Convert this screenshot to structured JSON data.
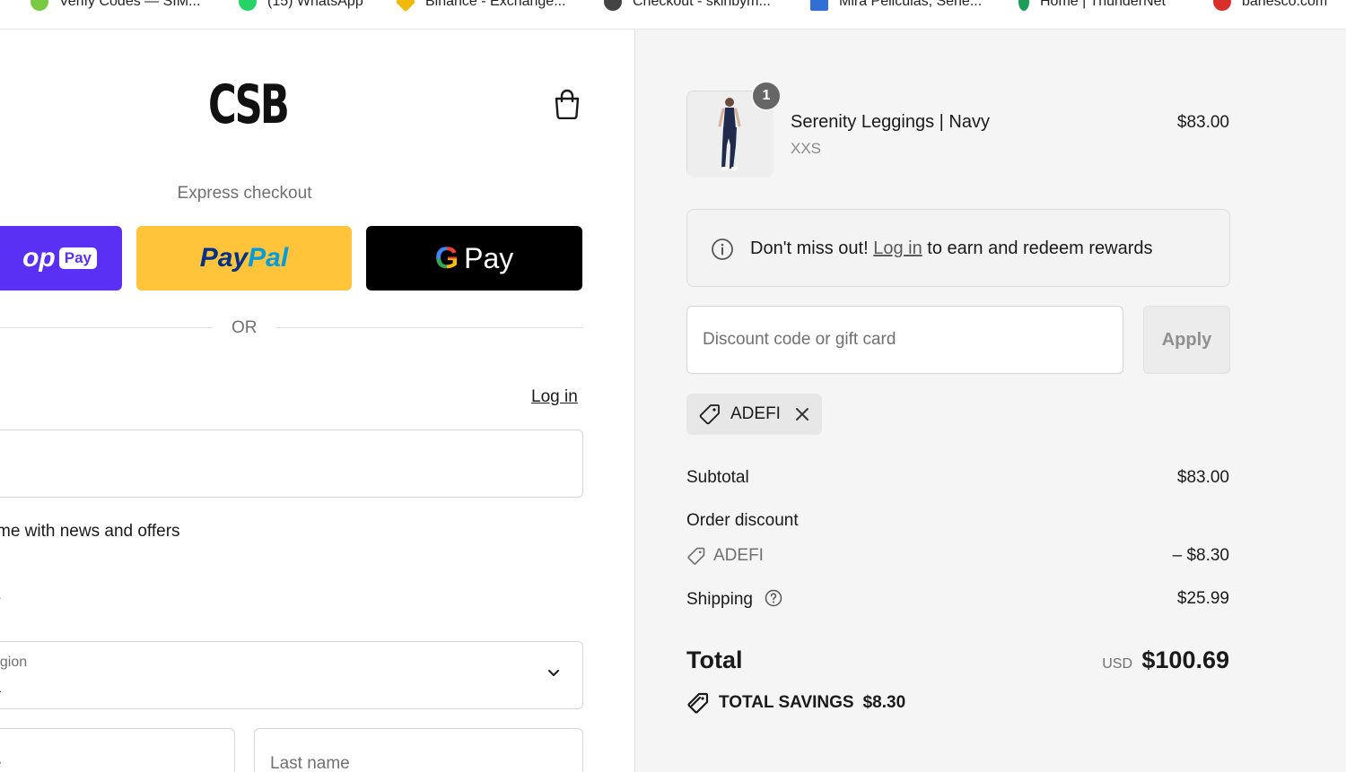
{
  "bookmarks": [
    {
      "label": "Verify Codes — SIM...",
      "icon": "verify-codes-icon",
      "color": "#7ac943"
    },
    {
      "label": "(15) WhatsApp",
      "icon": "whatsapp-icon",
      "color": "#25d366"
    },
    {
      "label": "Binance - Exchange...",
      "icon": "binance-icon",
      "color": "#f0b90b"
    },
    {
      "label": "Checkout - skinbym...",
      "icon": "globe-icon",
      "color": "#444444"
    },
    {
      "label": "Mira Peliculas, Serie...",
      "icon": "mira-icon",
      "color": "#2f6fd6"
    },
    {
      "label": "Home | ThunderNet",
      "icon": "thundernet-icon",
      "color": "#1a9e5a"
    },
    {
      "label": "banesco.com",
      "icon": "banesco-icon",
      "color": "#d9302c"
    }
  ],
  "header": {
    "logo": "CSB"
  },
  "express": {
    "label": "Express checkout",
    "shop_text": "op",
    "shop_pill": "Pay",
    "paypal_a": "Pay",
    "paypal_b": "Pal",
    "gpay_g": "G",
    "gpay_text": "Pay"
  },
  "divider": {
    "text": "OR"
  },
  "contact": {
    "heading": ":",
    "login": "Log in",
    "newsletter": "me with news and offers"
  },
  "delivery": {
    "heading": "/",
    "country_label": "egion",
    "country_value": "a",
    "first_name_placeholder": "e",
    "last_name_placeholder": "Last name"
  },
  "cart": {
    "quantity": "1",
    "product_name": "Serenity Leggings | Navy",
    "variant": "XXS",
    "price": "$83.00"
  },
  "rewards": {
    "prefix": "Don't miss out!",
    "link": "Log in",
    "suffix": "to earn and redeem rewards"
  },
  "discount": {
    "placeholder": "Discount code or gift card",
    "apply_label": "Apply",
    "applied_code": "ADEFI"
  },
  "summary": {
    "subtotal_label": "Subtotal",
    "subtotal_value": "$83.00",
    "order_discount_label": "Order discount",
    "discount_code": "ADEFI",
    "discount_value": "– $8.30",
    "shipping_label": "Shipping",
    "shipping_value": "$25.99",
    "total_label": "Total",
    "currency": "USD",
    "total_value": "$100.69",
    "savings_label": "TOTAL SAVINGS",
    "savings_value": "$8.30"
  },
  "colors": {
    "shop_pay": "#5a31f4",
    "paypal": "#ffc439",
    "gpay": "#000000",
    "summary_bg": "#f5f5f5"
  }
}
